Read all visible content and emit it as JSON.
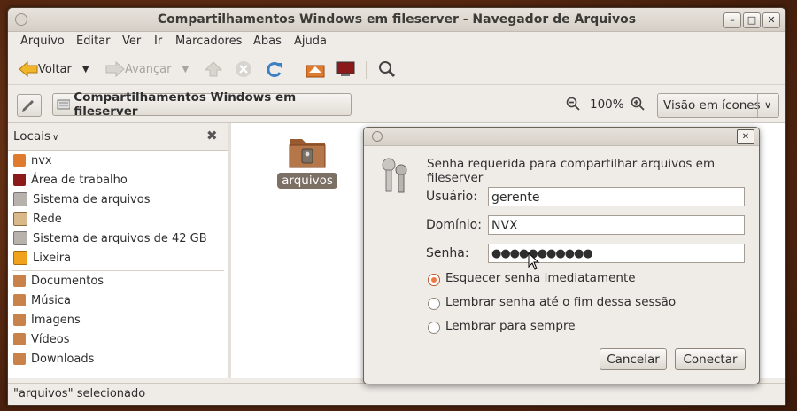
{
  "window": {
    "title": "Compartilhamentos Windows em fileserver - Navegador de Arquivos"
  },
  "menu": [
    "Arquivo",
    "Editar",
    "Ver",
    "Ir",
    "Marcadores",
    "Abas",
    "Ajuda"
  ],
  "toolbar": {
    "back": "Voltar",
    "forward": "Avançar"
  },
  "pathbar": {
    "location": "Compartilhamentos Windows em fileserver",
    "zoom": "100%",
    "view_mode": "Visão em ícones"
  },
  "sidebar": {
    "header": "Locais",
    "items": [
      {
        "label": "nvx",
        "icon": "home-folder-icon"
      },
      {
        "label": "Área de trabalho",
        "icon": "desktop-icon"
      },
      {
        "label": "Sistema de arquivos",
        "icon": "drive-icon"
      },
      {
        "label": "Rede",
        "icon": "network-icon"
      },
      {
        "label": "Sistema de arquivos de 42 GB",
        "icon": "drive-icon"
      },
      {
        "label": "Lixeira",
        "icon": "trash-icon"
      },
      {
        "label": "Documentos",
        "icon": "folder-icon"
      },
      {
        "label": "Música",
        "icon": "music-folder-icon"
      },
      {
        "label": "Imagens",
        "icon": "pictures-folder-icon"
      },
      {
        "label": "Vídeos",
        "icon": "videos-folder-icon"
      },
      {
        "label": "Downloads",
        "icon": "folder-icon"
      }
    ]
  },
  "content": {
    "share_name": "arquivos"
  },
  "status": "\"arquivos\" selecionado",
  "dialog": {
    "message": "Senha requerida para compartilhar arquivos em fileserver",
    "user_label": "Usuário:",
    "user_value": "gerente",
    "domain_label": "Domínio:",
    "domain_value": "NVX",
    "password_label": "Senha:",
    "password_value": "●●●●●●●●●●●",
    "radio_forget": "Esquecer senha imediatamente",
    "radio_session": "Lembrar senha até o fim dessa sessão",
    "radio_forever": "Lembrar para sempre",
    "cancel": "Cancelar",
    "connect": "Conectar",
    "selected_option": "Esquecer senha imediatamente"
  },
  "colors": {
    "accent": "#f07746",
    "selection": "#7c6f64",
    "folder": "#b5764a"
  }
}
